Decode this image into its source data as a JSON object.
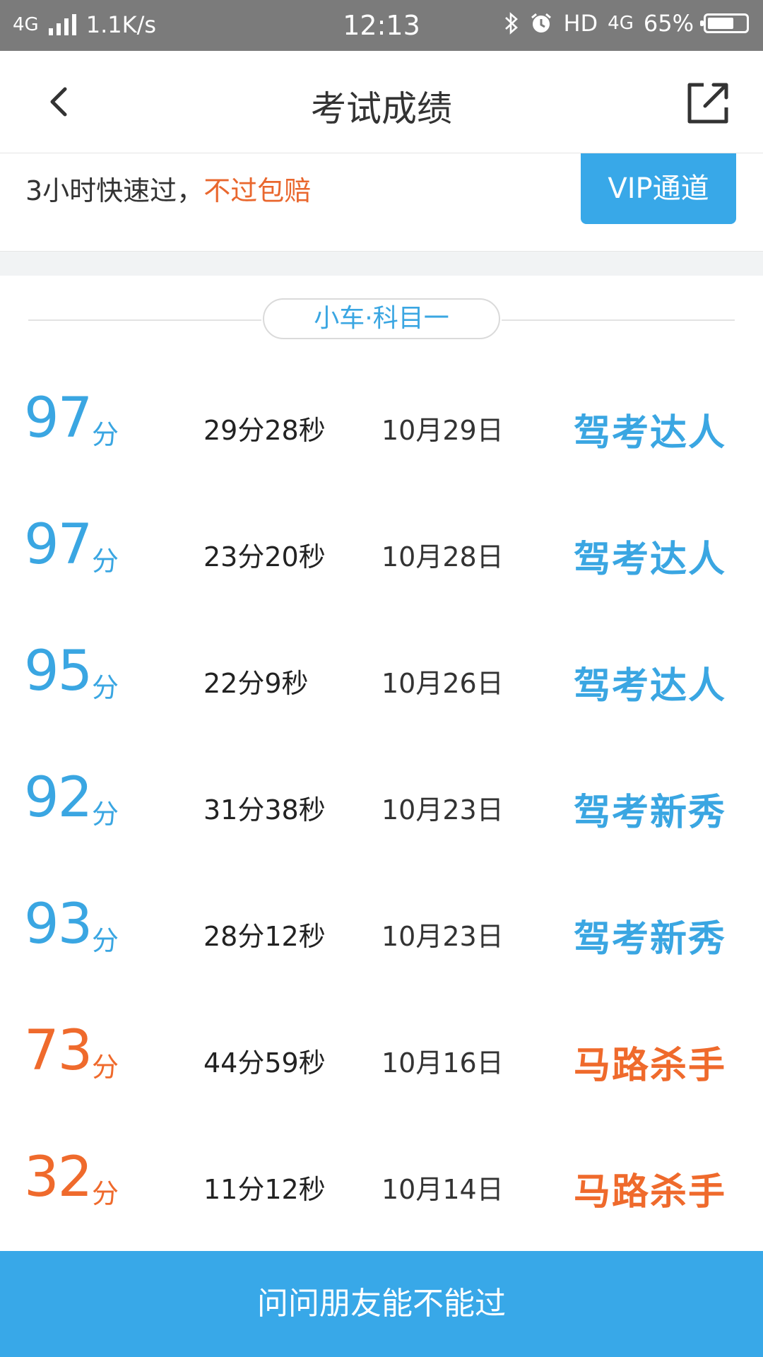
{
  "status_bar": {
    "network": "4G",
    "speed": "1.1K/s",
    "time": "12:13",
    "hd": "HD",
    "network_right": "4G",
    "battery": "65%"
  },
  "nav": {
    "title": "考试成绩"
  },
  "promo": {
    "text": "3小时快速过，",
    "highlight": "不过包赔",
    "vip_label": "VIP通道"
  },
  "section": {
    "label": "小车·科目一"
  },
  "records": [
    {
      "score": "97",
      "unit": "分",
      "duration": "29分28秒",
      "date": "10月29日",
      "rank": "驾考达人",
      "tone": "blue"
    },
    {
      "score": "97",
      "unit": "分",
      "duration": "23分20秒",
      "date": "10月28日",
      "rank": "驾考达人",
      "tone": "blue"
    },
    {
      "score": "95",
      "unit": "分",
      "duration": "22分9秒",
      "date": "10月26日",
      "rank": "驾考达人",
      "tone": "blue"
    },
    {
      "score": "92",
      "unit": "分",
      "duration": "31分38秒",
      "date": "10月23日",
      "rank": "驾考新秀",
      "tone": "blue"
    },
    {
      "score": "93",
      "unit": "分",
      "duration": "28分12秒",
      "date": "10月23日",
      "rank": "驾考新秀",
      "tone": "blue"
    },
    {
      "score": "73",
      "unit": "分",
      "duration": "44分59秒",
      "date": "10月16日",
      "rank": "马路杀手",
      "tone": "orange"
    },
    {
      "score": "32",
      "unit": "分",
      "duration": "11分12秒",
      "date": "10月14日",
      "rank": "马路杀手",
      "tone": "orange"
    }
  ],
  "bottom_button": {
    "label": "问问朋友能不能过"
  },
  "colors": {
    "accent_blue": "#38a8e8",
    "warn_orange": "#ef6a2c",
    "status_bar_bg": "#7b7b7b"
  },
  "icons": {
    "back": "back-arrow-icon",
    "share": "share-icon",
    "bluetooth": "bluetooth-icon",
    "alarm": "alarm-icon",
    "signal": "signal-icon",
    "battery": "battery-icon"
  }
}
